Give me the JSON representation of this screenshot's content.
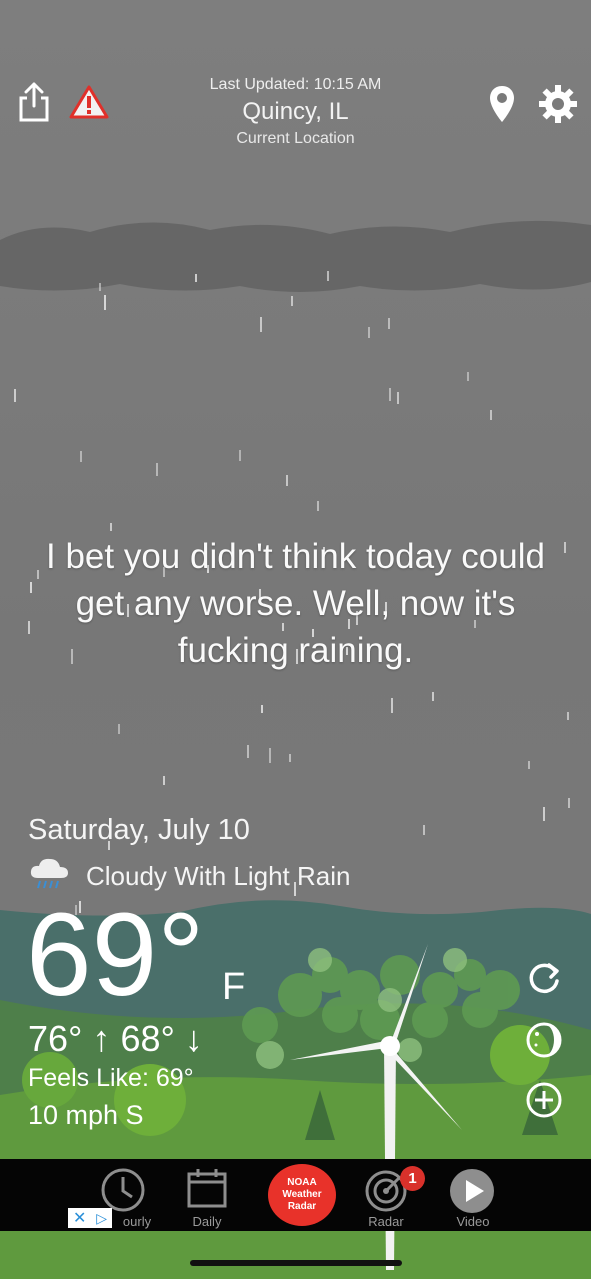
{
  "header": {
    "last_updated": "Last Updated: 10:15 AM",
    "city": "Quincy, IL",
    "location_label": "Current Location"
  },
  "message": "I bet you didn't think today could get any worse. Well, now it's fucking raining.",
  "forecast": {
    "date": "Saturday, July 10",
    "condition": "Cloudy With Light Rain",
    "condition_icon": "rain-cloud-icon",
    "temperature": "69°",
    "unit": "F",
    "hi_lo": "76° ↑ 68° ↓",
    "feels_like": "Feels Like: 69°",
    "wind": "10 mph S"
  },
  "tabbar": {
    "tabs": [
      {
        "label": "Hourly",
        "visible_label": "ourly",
        "icon": "clock-icon"
      },
      {
        "label": "Daily",
        "icon": "calendar-icon"
      },
      {
        "label": "NOAA Weather Radar",
        "icon": "noaa-button"
      },
      {
        "label": "Radar",
        "icon": "radar-icon",
        "badge": "1"
      },
      {
        "label": "Video",
        "icon": "play-icon"
      }
    ],
    "noaa_lines": [
      "NOAA",
      "Weather",
      "Radar"
    ]
  },
  "colors": {
    "sky": "#7a7a7a",
    "hills_far": "#4a6f6a",
    "grass": "#5f9a3e",
    "noaa_red": "#e8322a",
    "tabbar": "#050505"
  }
}
